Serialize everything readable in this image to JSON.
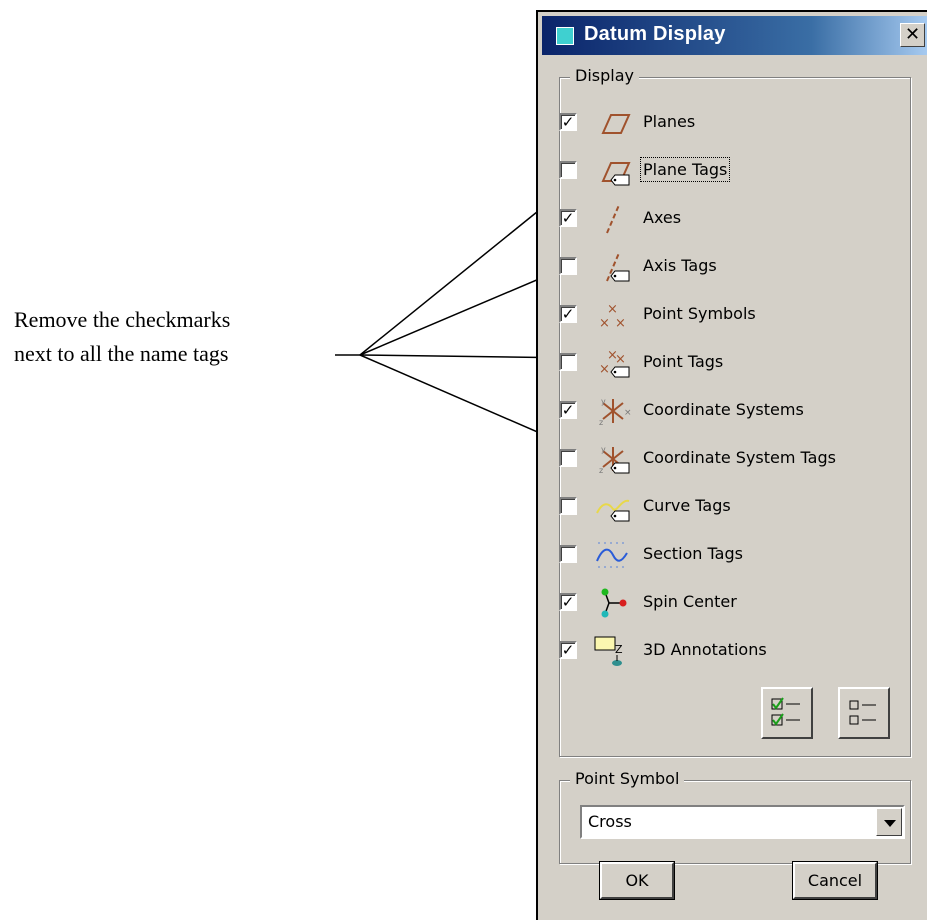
{
  "annotation": {
    "line1": "Remove the checkmarks",
    "line2": "next to all the name tags"
  },
  "dialog": {
    "title": "Datum Display",
    "close_label": "✕"
  },
  "display_group": {
    "legend": "Display",
    "items": [
      {
        "label": "Planes",
        "checked": true,
        "icon": "plane-icon"
      },
      {
        "label": "Plane Tags",
        "checked": false,
        "icon": "plane-tag-icon"
      },
      {
        "label": "Axes",
        "checked": true,
        "icon": "axis-icon"
      },
      {
        "label": "Axis Tags",
        "checked": false,
        "icon": "axis-tag-icon"
      },
      {
        "label": "Point Symbols",
        "checked": true,
        "icon": "point-symbols-icon"
      },
      {
        "label": "Point Tags",
        "checked": false,
        "icon": "point-tag-icon"
      },
      {
        "label": "Coordinate Systems",
        "checked": true,
        "icon": "coordinate-system-icon"
      },
      {
        "label": "Coordinate System Tags",
        "checked": false,
        "icon": "coordinate-system-tag-icon"
      },
      {
        "label": "Curve Tags",
        "checked": false,
        "icon": "curve-tag-icon"
      },
      {
        "label": "Section Tags",
        "checked": false,
        "icon": "section-tag-icon"
      },
      {
        "label": "Spin Center",
        "checked": true,
        "icon": "spin-center-icon"
      },
      {
        "label": "3D Annotations",
        "checked": true,
        "icon": "3d-annotations-icon"
      }
    ]
  },
  "point_symbol_group": {
    "legend": "Point Symbol",
    "selected": "Cross"
  },
  "buttons": {
    "ok": "OK",
    "cancel": "Cancel"
  },
  "colors": {
    "titlebar": "#0a246a",
    "dialog_bg": "#d4d0c8",
    "icon_brown": "#a0522d"
  }
}
